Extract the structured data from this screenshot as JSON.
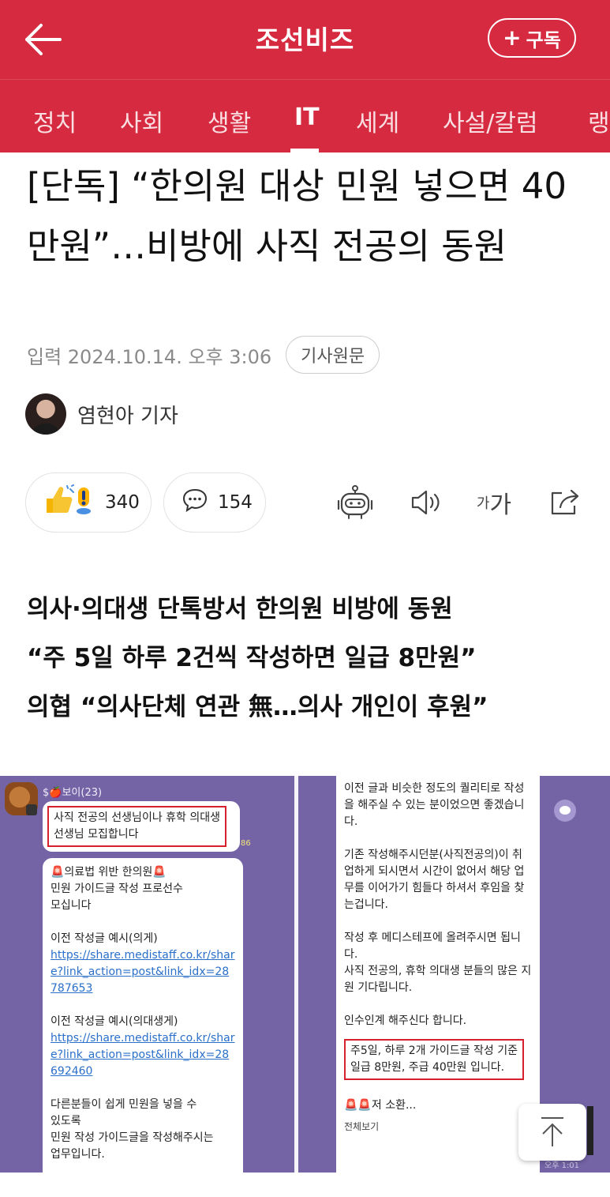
{
  "header": {
    "logo": "조선비즈",
    "subscribe_label": "구독",
    "subscribe_icon": "+"
  },
  "nav": {
    "items": [
      "정치",
      "사회",
      "생활",
      "IT",
      "세계",
      "사설/칼럼",
      "랭"
    ],
    "active": "IT"
  },
  "article": {
    "title": "[단독] “한의원 대상 민원 넣으면 40만원”…비방에 사직 전공의 동원",
    "date": "입력 2024.10.14. 오후 3:06",
    "original_label": "기사원문",
    "author": "염현아 기자"
  },
  "actions": {
    "reaction_count": "340",
    "comment_count": "154",
    "icons": [
      "reaction-icon",
      "comment-icon",
      "ai-bot-icon",
      "tts-speaker-icon",
      "font-size-icon",
      "share-icon"
    ],
    "font_small": "가",
    "font_large": "가"
  },
  "summary": [
    "의사·의대생 단톡방서 한의원 비방에 동원",
    "“주 5일 하루 2건씩 작성하면 일급 8만원”",
    "의협 “의사단체 연관 無…의사 개인이 후원”"
  ],
  "image": {
    "chat_name": "$🍎보이(23)",
    "left": {
      "bubble1_lines": [
        "사직 전공의 선생님이나 휴학 의대생",
        "선생님 모집합니다"
      ],
      "count": "86",
      "b2_title": "🚨의료법 위반 한의원🚨",
      "b2_l1": "민원 가이드글 작성 프로선수",
      "b2_l2": "모십니다",
      "b2_ex1": "이전 작성글 예시(의게)",
      "b2_link1": "https://share.medistaff.co.kr/share?link_action=post&link_idx=28787653",
      "b2_ex2": "이전 작성글 예시(의대생게)",
      "b2_link2": "https://share.medistaff.co.kr/share?link_action=post&link_idx=28692460",
      "b2_l3": "다른분들이 쉽게 민원을 넣을 수",
      "b2_l4": "있도록",
      "b2_l5": "민원 작성 가이드글을 작성해주시는",
      "b2_l6": "업무입니다."
    },
    "right": {
      "p1": "이전 글과 비슷한 정도의 퀄리티로 작성을 해주실 수 있는 분이었으면 좋겠습니다.",
      "p2": "기존 작성해주시던분(사직전공의)이 취업하게 되시면서 시간이 없어서 해당 업무를 이어가기 힘들다 하셔서 후임을 찾는겁니다.",
      "p3": "작성 후 메디스테프에 올려주시면 됩니다.",
      "p4": "사직 전공의, 휴학 의대생 분들의 많은 지원 기다립니다.",
      "p5": "인수인계 해주신다 합니다.",
      "highlight1": "주5일, 하루 2개 가이드글 작성 기준",
      "highlight2": "일급 8만원, 주급 40만원 입니다.",
      "tail": "🚨🚨저 소환...",
      "see_all": "전체보기",
      "time": "오후 1:01"
    }
  }
}
